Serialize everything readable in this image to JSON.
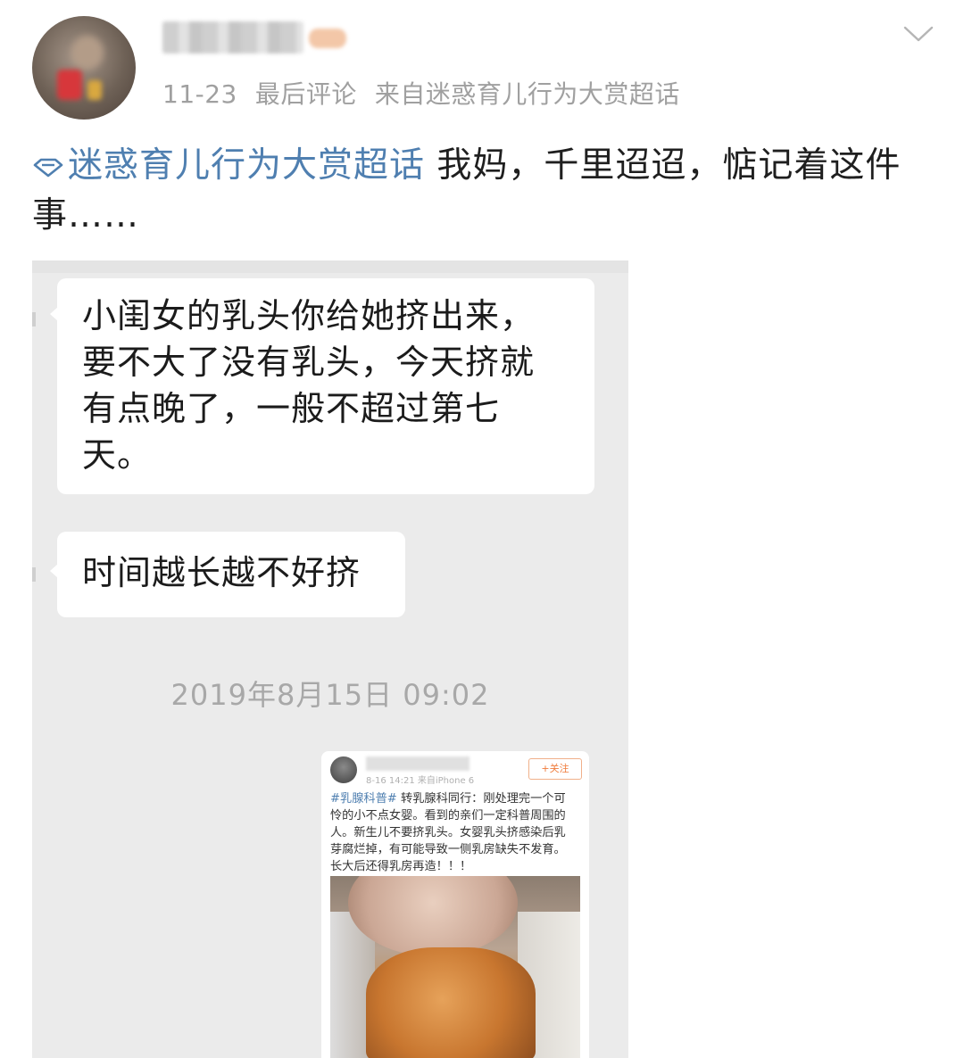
{
  "post": {
    "meta": {
      "date": "11-23",
      "last_comment": "最后评论",
      "source": "来自迷惑育儿行为大赏超话"
    },
    "topic": "迷惑育儿行为大赏超话",
    "text": " 我妈，千里迢迢，惦记着这件事……"
  },
  "chat": {
    "messages": [
      {
        "text": "小闺女的乳头你给她挤出来，\n要不大了没有乳头，今天挤就\n有点晚了，一般不超过第七\n天。"
      },
      {
        "text": "时间越长越不好挤"
      }
    ],
    "timestamp": "2019年8月15日 09:02"
  },
  "embedded_post": {
    "follow_label": "+关注",
    "hashtag": "#乳腺科普#",
    "body": " 转乳腺科同行：刚处理完一个可\n怜的小不点女婴。看到的亲们一定科普周围的\n人。新生儿不要挤乳头。女婴乳头挤感染后乳\n芽腐烂掉，有可能导致一侧乳房缺失不发育。\n长大后还得乳房再造！！！",
    "meta": "8-16 14:21  来自iPhone 6"
  },
  "colors": {
    "topic_link": "#4f7fb0",
    "meta_text": "#a0a0a0",
    "chat_background": "#ebebeb",
    "follow_accent": "#f07c3c"
  },
  "icons": {
    "topic": "super-topic-diamond-icon",
    "menu": "chevron-down-icon"
  }
}
